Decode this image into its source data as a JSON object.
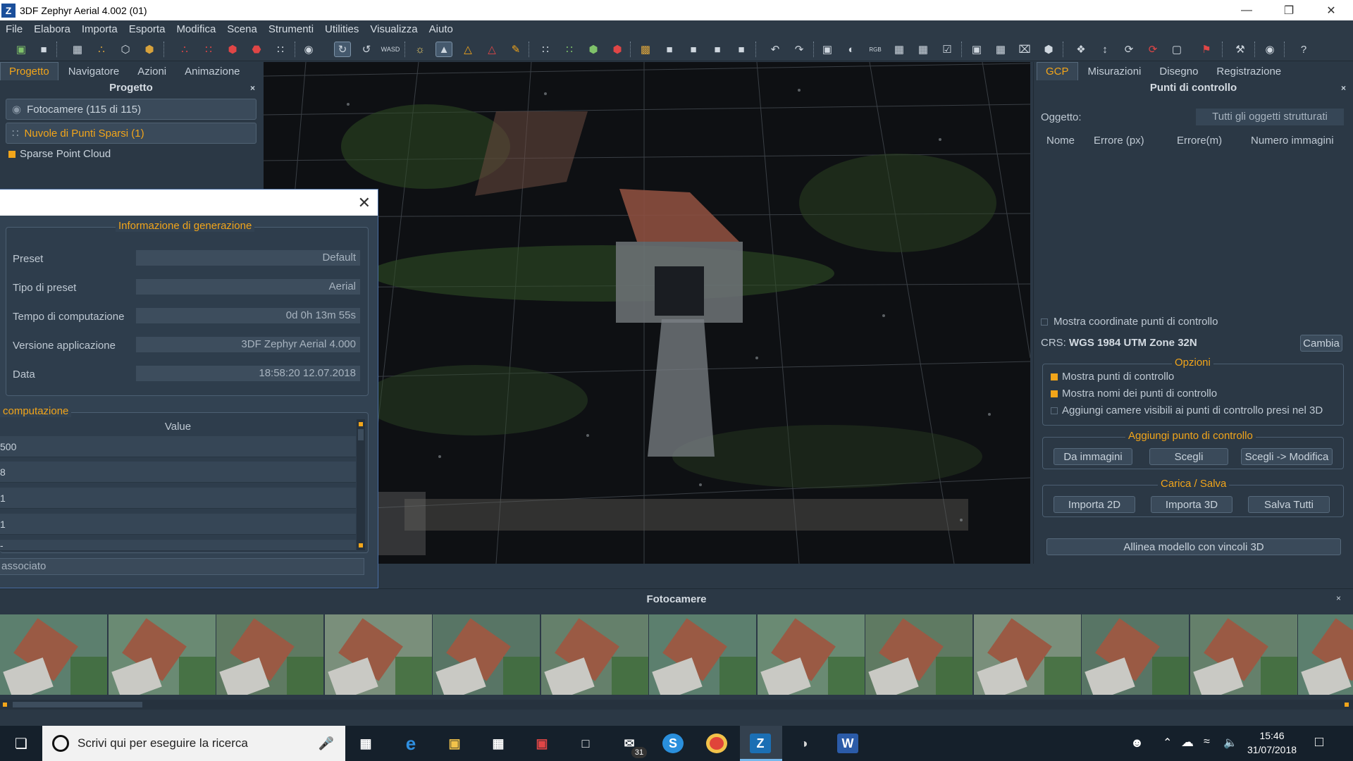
{
  "window": {
    "title": "3DF Zephyr Aerial 4.002 (01)",
    "logo_letter": "Z"
  },
  "menu": [
    "File",
    "Elabora",
    "Importa",
    "Esporta",
    "Modifica",
    "Scena",
    "Strumenti",
    "Utilities",
    "Visualizza",
    "Aiuto"
  ],
  "left_panel": {
    "tabs": [
      "Progetto",
      "Navigatore",
      "Azioni",
      "Animazione"
    ],
    "active_tab": "Progetto",
    "title": "Progetto",
    "items": [
      "Fotocamere (115 di 115)",
      "Nuvole di Punti Sparsi (1)"
    ],
    "subitem": "Sparse Point Cloud"
  },
  "dialog": {
    "group_title": "Informazione di generazione",
    "fields": [
      {
        "label": "Preset",
        "value": "Default"
      },
      {
        "label": "Tipo di preset",
        "value": "Aerial"
      },
      {
        "label": "Tempo di computazione",
        "value": "0d 0h 13m 55s"
      },
      {
        "label": "Versione applicazione",
        "value": "3DF Zephyr Aerial 4.000"
      },
      {
        "label": "Data",
        "value": "18:58:20 12.07.2018"
      }
    ],
    "comp_title": "computazione",
    "value_header": "Value",
    "rows": [
      "500",
      "8",
      "1",
      "1",
      "-"
    ],
    "bottom_label": "associato"
  },
  "right_panel": {
    "tabs": [
      "GCP",
      "Misurazioni",
      "Disegno",
      "Registrazione"
    ],
    "active_tab": "GCP",
    "title": "Punti di controllo",
    "object_label": "Oggetto:",
    "object_value": "Tutti gli oggetti strutturati",
    "columns": [
      "Nome",
      "Errore (px)",
      "Errore(m)",
      "Numero immagini"
    ],
    "show_coords_label": "Mostra coordinate punti di controllo",
    "crs_label": "CRS:",
    "crs_value": "WGS 1984 UTM Zone 32N",
    "change_button": "Cambia",
    "options_title": "Opzioni",
    "options": [
      {
        "label": "Mostra punti di controllo",
        "checked": true
      },
      {
        "label": "Mostra nomi dei punti di controllo",
        "checked": true
      },
      {
        "label": "Aggiungi camere visibili ai punti di controllo presi nel 3D",
        "checked": false
      }
    ],
    "add_title": "Aggiungi punto di controllo",
    "add_buttons": [
      "Da immagini",
      "Scegli",
      "Scegli -> Modifica"
    ],
    "load_title": "Carica / Salva",
    "load_buttons": [
      "Importa 2D",
      "Importa 3D",
      "Salva Tutti"
    ],
    "align_button": "Allinea modello con vincoli 3D"
  },
  "cameras": {
    "title": "Fotocamere"
  },
  "taskbar": {
    "search_placeholder": "Scrivi qui per eseguire la ricerca",
    "mail_badge": "31",
    "time": "15:46",
    "date": "31/07/2018"
  },
  "colors": {
    "accent": "#f2a51a",
    "panel": "#2b3845",
    "viewport": "#0e1013"
  }
}
